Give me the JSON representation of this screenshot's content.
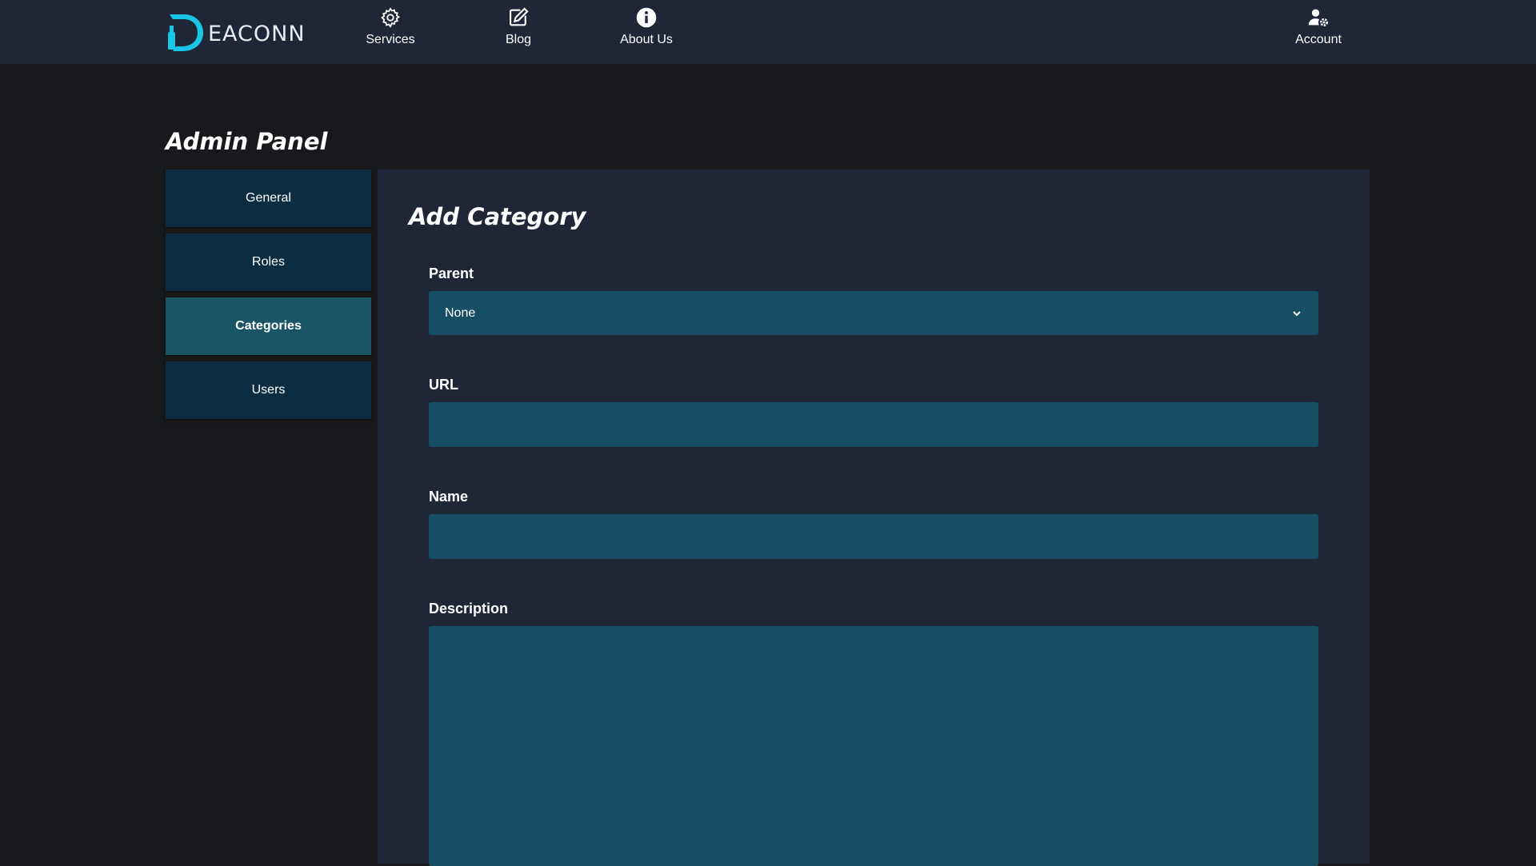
{
  "brand": {
    "logo_text": "EACONN",
    "logo_letter": "D",
    "accent_color": "#18c6e6"
  },
  "nav": {
    "items": [
      {
        "label": "Services",
        "icon": "gear-icon"
      },
      {
        "label": "Blog",
        "icon": "edit-icon"
      },
      {
        "label": "About Us",
        "icon": "info-icon"
      }
    ],
    "account": {
      "label": "Account",
      "icon": "user-cog-icon"
    }
  },
  "page": {
    "title": "Admin Panel"
  },
  "sidebar": {
    "items": [
      {
        "label": "General",
        "active": false
      },
      {
        "label": "Roles",
        "active": false
      },
      {
        "label": "Categories",
        "active": true
      },
      {
        "label": "Users",
        "active": false
      }
    ]
  },
  "form": {
    "title": "Add Category",
    "parent": {
      "label": "Parent",
      "value": "None"
    },
    "url": {
      "label": "URL",
      "value": ""
    },
    "name": {
      "label": "Name",
      "value": ""
    },
    "description": {
      "label": "Description",
      "value": ""
    }
  },
  "colors": {
    "background": "#18191d",
    "topbar": "#1e2638",
    "panel": "#1e2638",
    "sidebar_item": "#0c2d41",
    "sidebar_item_active": "#1a5566",
    "field": "#164f63"
  }
}
